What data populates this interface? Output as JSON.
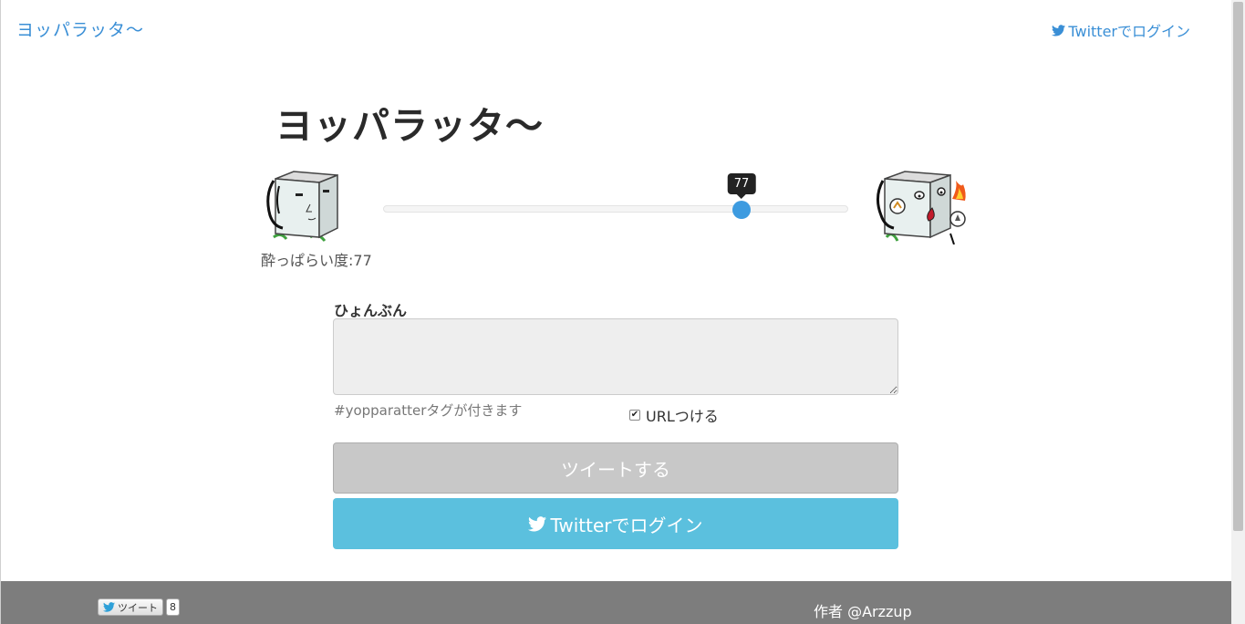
{
  "nav": {
    "brand": "ヨッパラッタ〜",
    "login": "Twitterでログイン"
  },
  "main": {
    "title": "ヨッパラッタ〜",
    "drunk_label": "酔っぱらい度:77",
    "slider": {
      "value": 77,
      "min": 0,
      "max": 100,
      "tooltip": "77"
    }
  },
  "form": {
    "label": "ひょんぶん",
    "textarea_value": "",
    "hint": "#yopparatterタグが付きます",
    "url_check_label": "URLつける",
    "url_checked": true,
    "tweet_button": "ツイートする",
    "login_button": "Twitterでログイン"
  },
  "footer": {
    "share_label": "ツイート",
    "share_count": "8",
    "author": "作者 @Arzzup"
  },
  "colors": {
    "link": "#3a8fd6",
    "slider_handle": "#3d9be0",
    "login_button": "#5bc0de",
    "tweet_button_disabled": "#c8c8c8",
    "footer": "#7d7d7d"
  },
  "icons": [
    "twitter-bird-icon",
    "checkbox-icon",
    "sober-face-icon",
    "drunk-face-icon"
  ]
}
